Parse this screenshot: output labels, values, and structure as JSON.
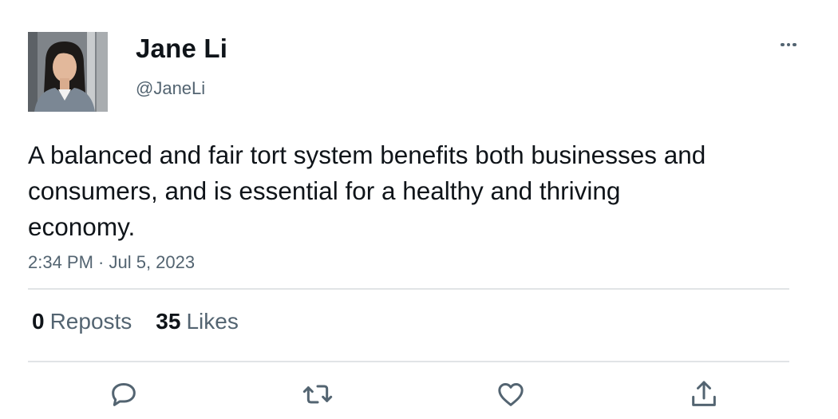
{
  "author": {
    "display_name": "Jane Li",
    "handle": "@JaneLi",
    "avatar_icon": "avatar-photo"
  },
  "tweet": {
    "text": "A balanced and fair tort system benefits both businesses and consumers, and is essential for a healthy and thriving economy.",
    "timestamp": "2:34 PM · Jul 5, 2023"
  },
  "stats": {
    "reposts_count": "0",
    "reposts_label": "Reposts",
    "likes_count": "35",
    "likes_label": "Likes"
  },
  "actions": [
    {
      "name": "reply",
      "icon": "speech-bubble-icon"
    },
    {
      "name": "repost",
      "icon": "repost-arrows-icon"
    },
    {
      "name": "like",
      "icon": "heart-icon"
    },
    {
      "name": "share",
      "icon": "share-upload-icon"
    }
  ],
  "colors": {
    "text_primary": "#0f1419",
    "text_secondary": "#536471",
    "divider": "#e1e4e6"
  }
}
